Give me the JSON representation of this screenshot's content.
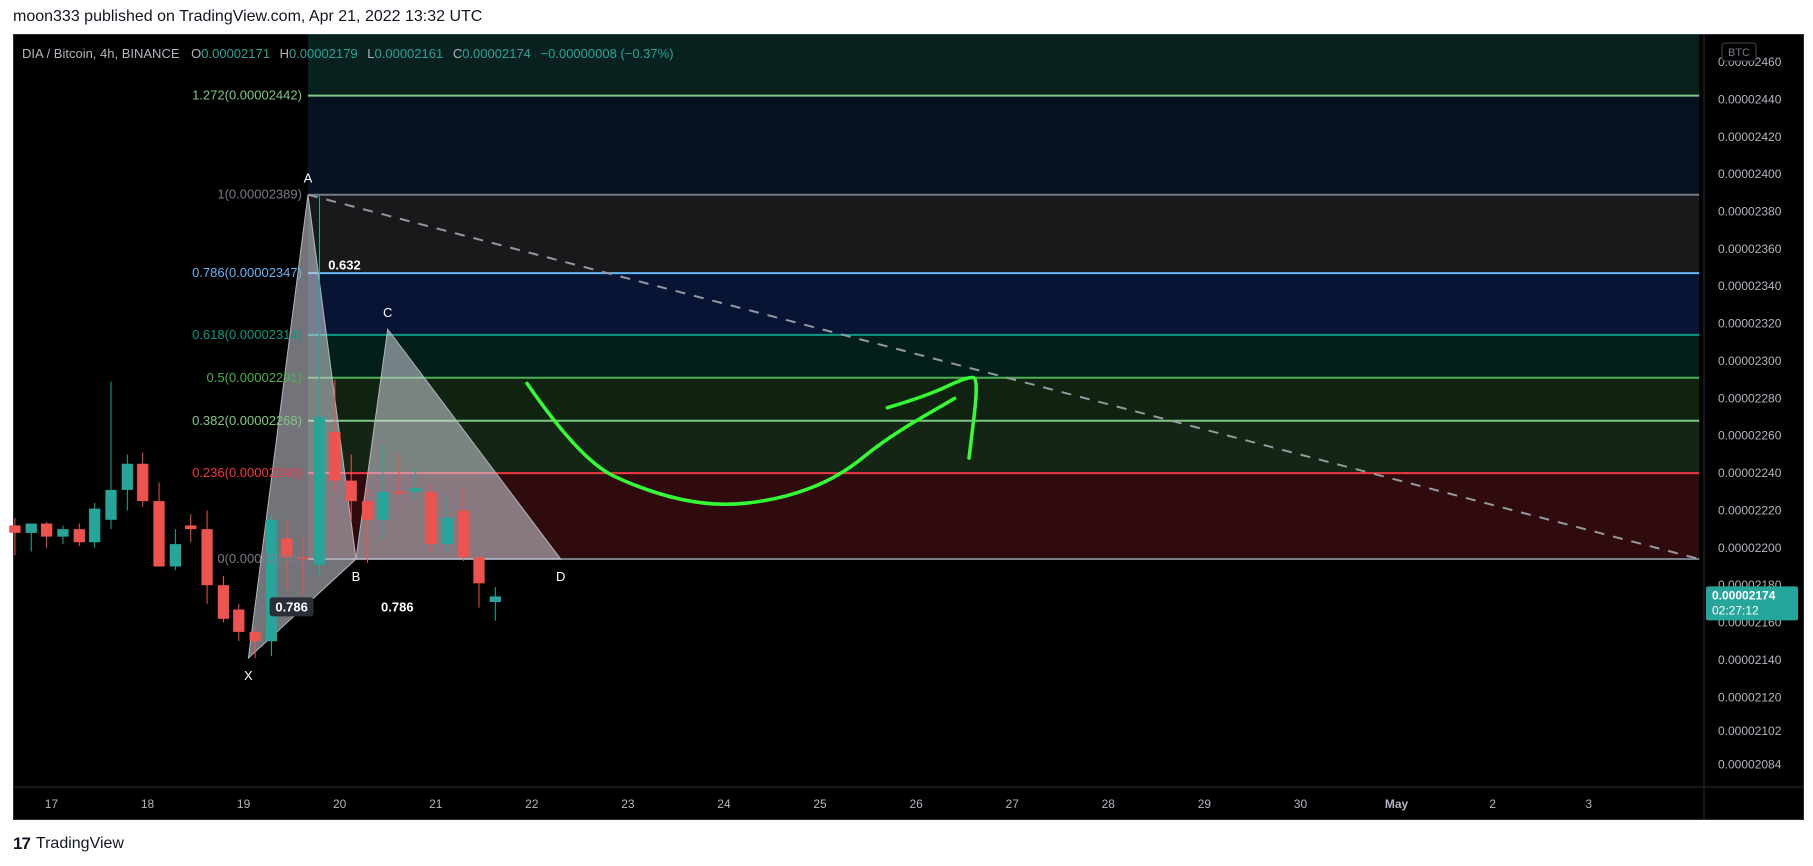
{
  "header": {
    "published": "moon333 published on TradingView.com, Apr 21, 2022 13:32 UTC"
  },
  "footer": {
    "brand": "TradingView"
  },
  "colors": {
    "background": "#000000",
    "bull": "#26a69a",
    "bear": "#ef5350",
    "fib_236": "#f23645",
    "fib_382": "#81c784",
    "fib_5": "#4caf50",
    "fib_618": "#089981",
    "fib_786": "#64b5f6",
    "fib_1": "#787b86",
    "fib_1272": "#81c784",
    "drawing": "#33ff33",
    "pattern": "#b2b5be"
  },
  "chart_data": {
    "type": "candlestick",
    "legend": {
      "symbol": "DIA / Bitcoin, 4h, BINANCE",
      "o_label": "O",
      "o": "0.00002171",
      "h_label": "H",
      "h": "0.00002179",
      "l_label": "L",
      "l": "0.00002161",
      "c_label": "C",
      "c": "0.00002174",
      "change": "−0.00000008 (−0.37%)"
    },
    "currency_badge": "BTC",
    "price_tag": {
      "price": "0.00002174",
      "countdown": "02:27:12",
      "value": 2.174e-05
    },
    "ylim": [
      2.072e-05,
      2.475e-05
    ],
    "y_ticks": [
      "0.00002460",
      "0.00002440",
      "0.00002420",
      "0.00002400",
      "0.00002380",
      "0.00002360",
      "0.00002340",
      "0.00002320",
      "0.00002300",
      "0.00002280",
      "0.00002260",
      "0.00002240",
      "0.00002220",
      "0.00002200",
      "0.00002180",
      "0.00002160",
      "0.00002140",
      "0.00002120",
      "0.00002102",
      "0.00002084"
    ],
    "x_ticks": [
      "17",
      "18",
      "19",
      "20",
      "21",
      "22",
      "23",
      "24",
      "25",
      "26",
      "27",
      "28",
      "29",
      "30",
      "May",
      "2",
      "3"
    ],
    "x_tick_days": [
      17,
      18,
      19,
      20,
      21,
      22,
      23,
      24,
      25,
      26,
      27,
      28,
      29,
      30,
      31,
      32,
      33
    ],
    "xlim_days": [
      16.6,
      34.2
    ],
    "candles": [
      {
        "t": 16.62,
        "o": 2.212e-05,
        "h": 2.216e-05,
        "l": 2.196e-05,
        "c": 2.208e-05
      },
      {
        "t": 16.79,
        "o": 2.208e-05,
        "h": 2.212e-05,
        "l": 2.198e-05,
        "c": 2.213e-05
      },
      {
        "t": 16.95,
        "o": 2.213e-05,
        "h": 2.214e-05,
        "l": 2.2e-05,
        "c": 2.206e-05
      },
      {
        "t": 17.12,
        "o": 2.206e-05,
        "h": 2.212e-05,
        "l": 2.202e-05,
        "c": 2.21e-05
      },
      {
        "t": 17.29,
        "o": 2.21e-05,
        "h": 2.213e-05,
        "l": 2.201e-05,
        "c": 2.203e-05
      },
      {
        "t": 17.45,
        "o": 2.203e-05,
        "h": 2.224e-05,
        "l": 2.2e-05,
        "c": 2.221e-05
      },
      {
        "t": 17.62,
        "o": 2.215e-05,
        "h": 2.289e-05,
        "l": 2.21e-05,
        "c": 2.231e-05
      },
      {
        "t": 17.79,
        "o": 2.231e-05,
        "h": 2.25e-05,
        "l": 2.22e-05,
        "c": 2.245e-05
      },
      {
        "t": 17.95,
        "o": 2.245e-05,
        "h": 2.251e-05,
        "l": 2.222e-05,
        "c": 2.225e-05
      },
      {
        "t": 18.12,
        "o": 2.225e-05,
        "h": 2.235e-05,
        "l": 2.19e-05,
        "c": 2.19e-05
      },
      {
        "t": 18.29,
        "o": 2.19e-05,
        "h": 2.21e-05,
        "l": 2.188e-05,
        "c": 2.202e-05
      },
      {
        "t": 18.45,
        "o": 2.212e-05,
        "h": 2.218e-05,
        "l": 2.203e-05,
        "c": 2.21e-05
      },
      {
        "t": 18.62,
        "o": 2.21e-05,
        "h": 2.22e-05,
        "l": 2.17e-05,
        "c": 2.18e-05
      },
      {
        "t": 18.79,
        "o": 2.18e-05,
        "h": 2.185e-05,
        "l": 2.16e-05,
        "c": 2.162e-05
      },
      {
        "t": 18.95,
        "o": 2.167e-05,
        "h": 2.17e-05,
        "l": 2.15e-05,
        "c": 2.155e-05
      },
      {
        "t": 19.12,
        "o": 2.155e-05,
        "h": 2.158e-05,
        "l": 2.141e-05,
        "c": 2.15e-05
      },
      {
        "t": 19.29,
        "o": 2.15e-05,
        "h": 2.218e-05,
        "l": 2.142e-05,
        "c": 2.215e-05
      },
      {
        "t": 19.45,
        "o": 2.205e-05,
        "h": 2.215e-05,
        "l": 2.178e-05,
        "c": 2.195e-05
      },
      {
        "t": 19.62,
        "o": 2.195e-05,
        "h": 2.206e-05,
        "l": 2.175e-05,
        "c": 2.194e-05
      },
      {
        "t": 19.79,
        "o": 2.191e-05,
        "h": 2.389e-05,
        "l": 2.185e-05,
        "c": 2.27e-05
      },
      {
        "t": 19.95,
        "o": 2.262e-05,
        "h": 2.29e-05,
        "l": 2.23e-05,
        "c": 2.236e-05
      },
      {
        "t": 20.12,
        "o": 2.236e-05,
        "h": 2.25e-05,
        "l": 2.215e-05,
        "c": 2.225e-05
      },
      {
        "t": 20.29,
        "o": 2.225e-05,
        "h": 2.232e-05,
        "l": 2.192e-05,
        "c": 2.215e-05
      },
      {
        "t": 20.45,
        "o": 2.215e-05,
        "h": 2.255e-05,
        "l": 2.205e-05,
        "c": 2.23e-05
      },
      {
        "t": 20.62,
        "o": 2.23e-05,
        "h": 2.25e-05,
        "l": 2.228e-05,
        "c": 2.229e-05
      },
      {
        "t": 20.79,
        "o": 2.23e-05,
        "h": 2.243e-05,
        "l": 2.225e-05,
        "c": 2.232e-05
      },
      {
        "t": 20.95,
        "o": 2.23e-05,
        "h": 2.234e-05,
        "l": 2.198e-05,
        "c": 2.202e-05
      },
      {
        "t": 21.12,
        "o": 2.202e-05,
        "h": 2.227e-05,
        "l": 2.198e-05,
        "c": 2.216e-05
      },
      {
        "t": 21.29,
        "o": 2.22e-05,
        "h": 2.232e-05,
        "l": 2.193e-05,
        "c": 2.195e-05
      },
      {
        "t": 21.45,
        "o": 2.195e-05,
        "h": 2.195e-05,
        "l": 2.168e-05,
        "c": 2.181e-05
      },
      {
        "t": 21.62,
        "o": 2.171e-05,
        "h": 2.179e-05,
        "l": 2.161e-05,
        "c": 2.174e-05
      }
    ],
    "fib_levels": [
      {
        "ratio": "1.272",
        "price": "0.00002442",
        "value": 2.442e-05,
        "label": "1.272(0.00002442)",
        "color": "#81c784"
      },
      {
        "ratio": "1",
        "price": "0.00002389",
        "value": 2.389e-05,
        "label": "1(0.00002389)",
        "color": "#787b86"
      },
      {
        "ratio": "0.786",
        "price": "0.00002347",
        "value": 2.347e-05,
        "label": "0.786(0.00002347)",
        "color": "#64b5f6"
      },
      {
        "ratio": "0.618",
        "price": "0.00002314",
        "value": 2.314e-05,
        "label": "0.618(0.00002314)",
        "color": "#089981"
      },
      {
        "ratio": "0.5",
        "price": "0.00002291",
        "value": 2.291e-05,
        "label": "0.5(0.00002291)",
        "color": "#4caf50"
      },
      {
        "ratio": "0.382",
        "price": "0.00002268",
        "value": 2.268e-05,
        "label": "0.382(0.00002268)",
        "color": "#81c784"
      },
      {
        "ratio": "0.236",
        "price": "0.00002240",
        "value": 2.24e-05,
        "label": "0.236(0.00002240)",
        "color": "#f23645"
      },
      {
        "ratio": "0",
        "price": "0.00002194",
        "value": 2.194e-05,
        "label": "0(0.00002194)",
        "color": "#787b86"
      }
    ],
    "fib_zones": [
      {
        "from": 2.442e-05,
        "to": 2.475e-05,
        "color": "#26a69a"
      },
      {
        "from": 2.389e-05,
        "to": 2.442e-05,
        "color": "#1e5b9a"
      },
      {
        "from": 2.347e-05,
        "to": 2.389e-05,
        "color": "#787b86"
      },
      {
        "from": 2.314e-05,
        "to": 2.347e-05,
        "color": "#2962ff"
      },
      {
        "from": 2.291e-05,
        "to": 2.314e-05,
        "color": "#089981"
      },
      {
        "from": 2.268e-05,
        "to": 2.291e-05,
        "color": "#4caf50"
      },
      {
        "from": 2.24e-05,
        "to": 2.268e-05,
        "color": "#66bb6a"
      },
      {
        "from": 2.194e-05,
        "to": 2.24e-05,
        "color": "#f23645"
      }
    ],
    "fib_x_range": [
      19.67,
      34.15
    ],
    "pattern_points": [
      {
        "name": "X",
        "t": 19.05,
        "p": 2.141e-05
      },
      {
        "name": "A",
        "t": 19.67,
        "p": 2.389e-05
      },
      {
        "name": "B",
        "t": 20.17,
        "p": 2.194e-05
      },
      {
        "name": "C",
        "t": 20.5,
        "p": 2.317e-05
      },
      {
        "name": "D",
        "t": 22.3,
        "p": 2.194e-05
      }
    ],
    "ratio_labels": [
      {
        "text": "0.786",
        "t": 19.5,
        "p": 2.166e-05,
        "boxed": true
      },
      {
        "text": "0.632",
        "t": 20.05,
        "p": 2.349e-05,
        "boxed": false
      },
      {
        "text": "0.786",
        "t": 20.6,
        "p": 2.166e-05,
        "boxed": false
      }
    ],
    "trendline": {
      "t1": 19.67,
      "p1": 2.389e-05,
      "t2": 34.15,
      "p2": 2.194e-05
    },
    "drawing_curve": [
      {
        "t": 21.95,
        "p": 2.288e-05
      },
      {
        "t": 22.5,
        "p": 2.247e-05
      },
      {
        "t": 23.2,
        "p": 2.23e-05
      },
      {
        "t": 23.9,
        "p": 2.222e-05
      },
      {
        "t": 24.6,
        "p": 2.226e-05
      },
      {
        "t": 25.2,
        "p": 2.238e-05
      },
      {
        "t": 25.7,
        "p": 2.259e-05
      },
      {
        "t": 26.4,
        "p": 2.28e-05
      }
    ],
    "drawing_hook": [
      {
        "t": 25.7,
        "p": 2.275e-05
      },
      {
        "t": 26.1,
        "p": 2.281e-05
      },
      {
        "t": 26.55,
        "p": 2.292e-05
      },
      {
        "t": 26.65,
        "p": 2.29e-05
      },
      {
        "t": 26.55,
        "p": 2.248e-05
      }
    ]
  }
}
